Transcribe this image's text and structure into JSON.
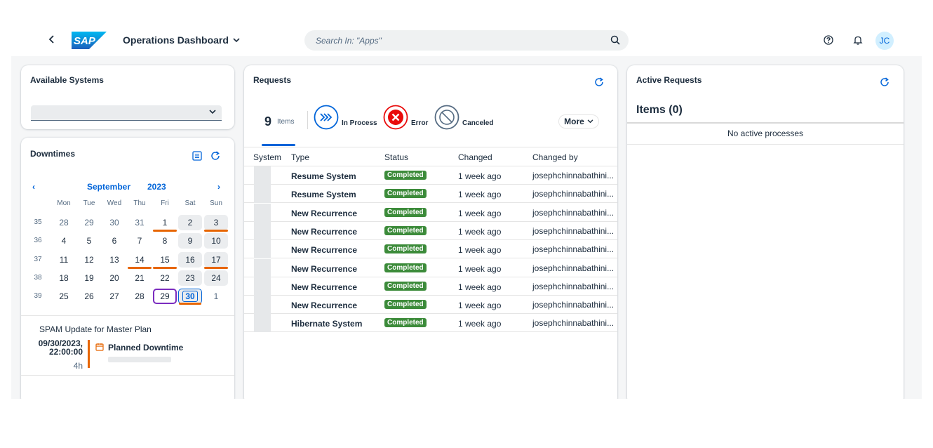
{
  "shell": {
    "app_title": "Operations Dashboard",
    "search_placeholder": "Search In: \"Apps\"",
    "avatar_initials": "JC",
    "logo_text": "SAP"
  },
  "available_systems": {
    "title": "Available Systems",
    "selected_value": ""
  },
  "downtimes": {
    "title": "Downtimes",
    "month": "September",
    "year": "2023",
    "weekdays": [
      "Mon",
      "Tue",
      "Wed",
      "Thu",
      "Fri",
      "Sat",
      "Sun"
    ],
    "weeks": [
      {
        "num": "35",
        "days": [
          "28",
          "29",
          "30",
          "31",
          "1",
          "2",
          "3"
        ]
      },
      {
        "num": "36",
        "days": [
          "4",
          "5",
          "6",
          "7",
          "8",
          "9",
          "10"
        ]
      },
      {
        "num": "37",
        "days": [
          "11",
          "12",
          "13",
          "14",
          "15",
          "16",
          "17"
        ]
      },
      {
        "num": "38",
        "days": [
          "18",
          "19",
          "20",
          "21",
          "22",
          "23",
          "24"
        ]
      },
      {
        "num": "39",
        "days": [
          "25",
          "26",
          "27",
          "28",
          "29",
          "30",
          "1"
        ]
      }
    ],
    "event_title": "SPAM Update for Master Plan",
    "event_date": "09/30/2023,",
    "event_time": "22:00:00",
    "event_duration": "4h",
    "event_type": "Planned Downtime"
  },
  "requests": {
    "title": "Requests",
    "count": "9",
    "count_label": "Items",
    "filters": {
      "in_process": "In Process",
      "error": "Error",
      "canceled": "Canceled"
    },
    "more_label": "More",
    "columns": [
      "System",
      "Type",
      "Status",
      "Changed",
      "Changed by"
    ],
    "rows": [
      {
        "type": "Resume System",
        "status": "Completed",
        "changed": "1 week ago",
        "by": "josephchinnabathini..."
      },
      {
        "type": "Resume System",
        "status": "Completed",
        "changed": "1 week ago",
        "by": "josephchinnabathini..."
      },
      {
        "type": "New Recurrence",
        "status": "Completed",
        "changed": "1 week ago",
        "by": "josephchinnabathini..."
      },
      {
        "type": "New Recurrence",
        "status": "Completed",
        "changed": "1 week ago",
        "by": "josephchinnabathini..."
      },
      {
        "type": "New Recurrence",
        "status": "Completed",
        "changed": "1 week ago",
        "by": "josephchinnabathini..."
      },
      {
        "type": "New Recurrence",
        "status": "Completed",
        "changed": "1 week ago",
        "by": "josephchinnabathini..."
      },
      {
        "type": "New Recurrence",
        "status": "Completed",
        "changed": "1 week ago",
        "by": "josephchinnabathini..."
      },
      {
        "type": "New Recurrence",
        "status": "Completed",
        "changed": "1 week ago",
        "by": "josephchinnabathini..."
      },
      {
        "type": "Hibernate System",
        "status": "Completed",
        "changed": "1 week ago",
        "by": "josephchinnabathini..."
      }
    ]
  },
  "active_requests": {
    "title": "Active Requests",
    "items_heading": "Items (0)",
    "empty_text": "No active processes"
  },
  "colors": {
    "accent": "#0064d9",
    "error": "#e90b0b",
    "success": "#3c8b3a",
    "downtime": "#e76500",
    "today": "#7b2cbf"
  }
}
